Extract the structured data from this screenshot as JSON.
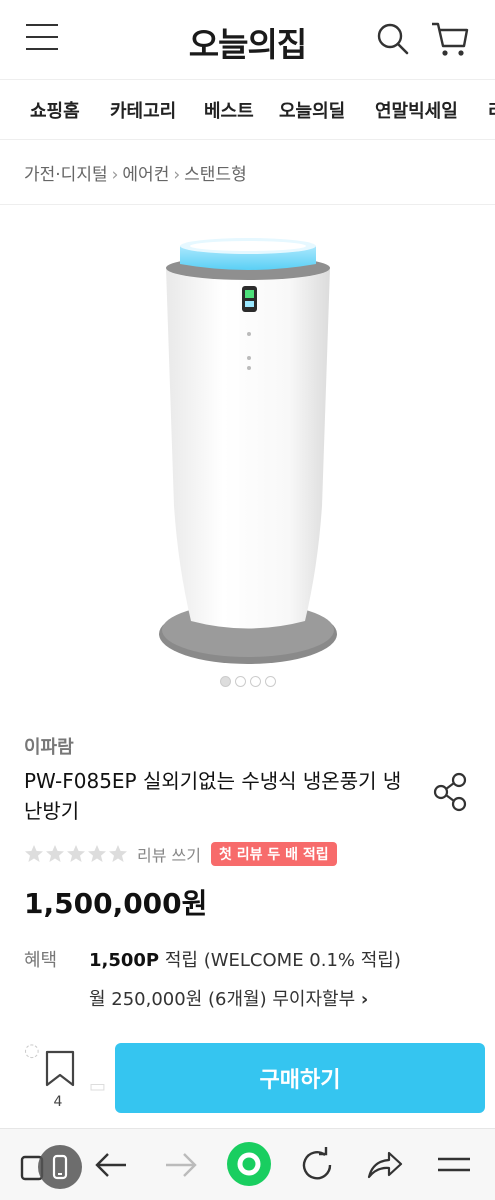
{
  "header": {
    "logo": "오늘의집"
  },
  "nav": {
    "items": [
      "쇼핑홈",
      "카테고리",
      "베스트",
      "오늘의딜",
      "연말빅세일",
      "리"
    ]
  },
  "breadcrumb": [
    "가전·디지털",
    "에어컨",
    "스탠드형"
  ],
  "product": {
    "brand": "이파람",
    "title": "PW-F085EP 실외기없는 수냉식 냉온풍기 냉난방기",
    "rating": 0,
    "rating_max": 5,
    "review_link": "리뷰 쓰기",
    "badge": "첫 리뷰 두 배 적립",
    "price": "1,500,000원",
    "image_count": 4,
    "image_index": 1
  },
  "benefit": {
    "label": "혜택",
    "points": "1,500P",
    "points_suffix": " 적립 (WELCOME 0.1% 적립)",
    "installment": "월 250,000원 (6개월) 무이자할부",
    "installment_arrow": "›"
  },
  "buy_bar": {
    "bookmark_count": "4",
    "buy_label": "구매하기"
  },
  "colors": {
    "accent": "#35c5f0",
    "badge": "#f76b6b",
    "browser_home": "#19ce60"
  }
}
